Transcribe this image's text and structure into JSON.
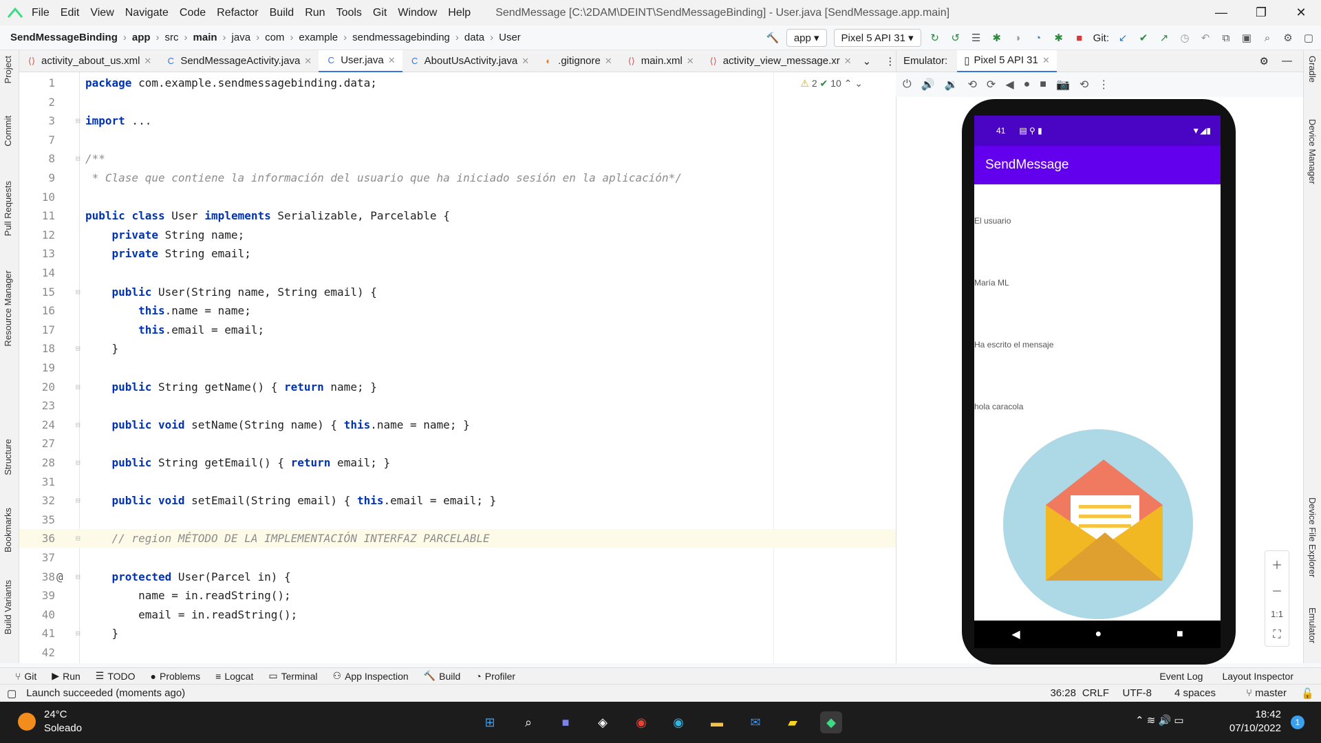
{
  "window": {
    "title": "SendMessage [C:\\2DAM\\DEINT\\SendMessageBinding] - User.java [SendMessage.app.main]"
  },
  "menu": [
    "File",
    "Edit",
    "View",
    "Navigate",
    "Code",
    "Refactor",
    "Build",
    "Run",
    "Tools",
    "Git",
    "Window",
    "Help"
  ],
  "breadcrumbs": [
    "SendMessageBinding",
    "app",
    "src",
    "main",
    "java",
    "com",
    "example",
    "sendmessagebinding",
    "data",
    "User"
  ],
  "toolbar": {
    "config": "app",
    "device": "Pixel 5 API 31",
    "git_label": "Git:"
  },
  "tabs": [
    {
      "label": "activity_about_us.xml",
      "icon": "xml"
    },
    {
      "label": "SendMessageActivity.java",
      "icon": "class"
    },
    {
      "label": "User.java",
      "icon": "class",
      "active": true
    },
    {
      "label": "AboutUsActivity.java",
      "icon": "class"
    },
    {
      "label": ".gitignore",
      "icon": "git"
    },
    {
      "label": "main.xml",
      "icon": "xml"
    },
    {
      "label": "activity_view_message.xr",
      "icon": "xml"
    }
  ],
  "editor": {
    "warnings": "2",
    "checks": "10",
    "lines": [
      {
        "n": "1",
        "t": "package com.example.sendmessagebinding.data;"
      },
      {
        "n": "2",
        "t": ""
      },
      {
        "n": "3",
        "t": "import ..."
      },
      {
        "n": "7",
        "t": ""
      },
      {
        "n": "8",
        "t": "/**"
      },
      {
        "n": "9",
        "t": " * Clase que contiene la información del usuario que ha iniciado sesión en la aplicación*/"
      },
      {
        "n": "10",
        "t": ""
      },
      {
        "n": "11",
        "t": "public class User implements Serializable, Parcelable {"
      },
      {
        "n": "12",
        "t": "    private String name;"
      },
      {
        "n": "13",
        "t": "    private String email;"
      },
      {
        "n": "14",
        "t": ""
      },
      {
        "n": "15",
        "t": "    public User(String name, String email) {"
      },
      {
        "n": "16",
        "t": "        this.name = name;"
      },
      {
        "n": "17",
        "t": "        this.email = email;"
      },
      {
        "n": "18",
        "t": "    }"
      },
      {
        "n": "19",
        "t": ""
      },
      {
        "n": "20",
        "t": "    public String getName() { return name; }"
      },
      {
        "n": "23",
        "t": ""
      },
      {
        "n": "24",
        "t": "    public void setName(String name) { this.name = name; }"
      },
      {
        "n": "27",
        "t": ""
      },
      {
        "n": "28",
        "t": "    public String getEmail() { return email; }"
      },
      {
        "n": "31",
        "t": ""
      },
      {
        "n": "32",
        "t": "    public void setEmail(String email) { this.email = email; }"
      },
      {
        "n": "35",
        "t": ""
      },
      {
        "n": "36",
        "t": "    // region MÉTODO DE LA IMPLEMENTACIÓN INTERFAZ PARCELABLE"
      },
      {
        "n": "37",
        "t": ""
      },
      {
        "n": "38",
        "t": "    protected User(Parcel in) {"
      },
      {
        "n": "39",
        "t": "        name = in.readString();"
      },
      {
        "n": "40",
        "t": "        email = in.readString();"
      },
      {
        "n": "41",
        "t": "    }"
      },
      {
        "n": "42",
        "t": ""
      }
    ]
  },
  "emulator": {
    "label": "Emulator:",
    "tab": "Pixel 5 API 31",
    "status_time": "41",
    "app_title": "SendMessage",
    "texts": [
      "El usuario",
      "María ML",
      "Ha escrito el mensaje",
      "hola caracola"
    ]
  },
  "zoom": {
    "ratio": "1:1"
  },
  "left_tools": [
    "Project",
    "Commit",
    "Pull Requests",
    "Resource Manager",
    "Structure",
    "Bookmarks",
    "Build Variants"
  ],
  "right_tools": [
    "Gradle",
    "Device Manager",
    "Device File Explorer",
    "Emulator"
  ],
  "bottom_tools": [
    "Git",
    "Run",
    "TODO",
    "Problems",
    "Logcat",
    "Terminal",
    "App Inspection",
    "Build",
    "Profiler"
  ],
  "bottom_right": [
    "Event Log",
    "Layout Inspector"
  ],
  "statusbar": {
    "message": "Launch succeeded (moments ago)",
    "position": "36:28",
    "line_sep": "CRLF",
    "encoding": "UTF-8",
    "indent": "4 spaces",
    "branch": "master"
  },
  "taskbar": {
    "temp": "24°C",
    "weather": "Soleado",
    "time": "18:42",
    "date": "07/10/2022",
    "badge": "1"
  }
}
